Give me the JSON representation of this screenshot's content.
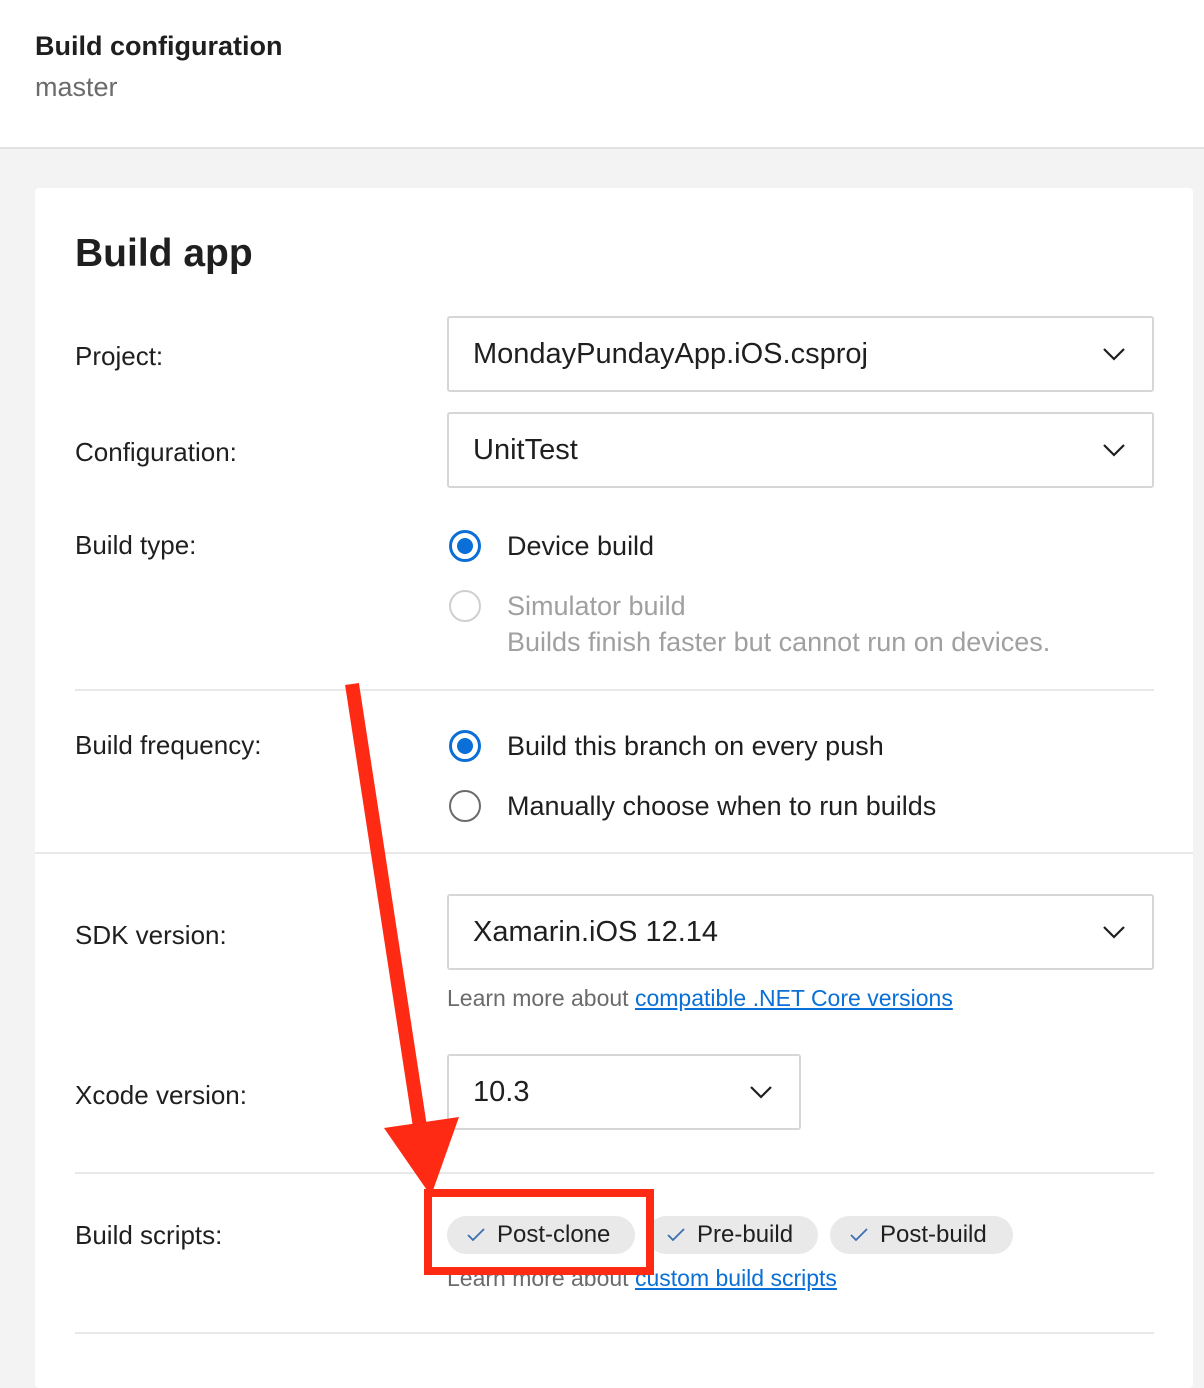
{
  "header": {
    "title": "Build configuration",
    "branch": "master"
  },
  "card": {
    "title": "Build app",
    "project": {
      "label": "Project:",
      "value": "MondayPundayApp.iOS.csproj"
    },
    "configuration": {
      "label": "Configuration:",
      "value": "UnitTest"
    },
    "build_type": {
      "label": "Build type:",
      "options": [
        {
          "label": "Device build",
          "checked": true,
          "disabled": false
        },
        {
          "label": "Simulator build",
          "help": "Builds finish faster but cannot run on devices.",
          "checked": false,
          "disabled": true
        }
      ]
    },
    "build_frequency": {
      "label": "Build frequency:",
      "options": [
        {
          "label": "Build this branch on every push",
          "checked": true
        },
        {
          "label": "Manually choose when to run builds",
          "checked": false
        }
      ]
    },
    "sdk_version": {
      "label": "SDK version:",
      "value": "Xamarin.iOS 12.14",
      "help_prefix": "Learn more about",
      "help_link": "compatible .NET Core versions"
    },
    "xcode_version": {
      "label": "Xcode version:",
      "value": "10.3"
    },
    "build_scripts": {
      "label": "Build scripts:",
      "scripts": [
        {
          "label": "Post-clone",
          "enabled": true
        },
        {
          "label": "Pre-build",
          "enabled": true
        },
        {
          "label": "Post-build",
          "enabled": true
        }
      ],
      "help_prefix": "Learn more about",
      "help_link": "custom build scripts"
    }
  },
  "annotation": {
    "color": "#ff2a14",
    "highlight_target": "Post-clone"
  },
  "colors": {
    "accent": "#0a6fd6",
    "annotation": "#ff2a14"
  }
}
